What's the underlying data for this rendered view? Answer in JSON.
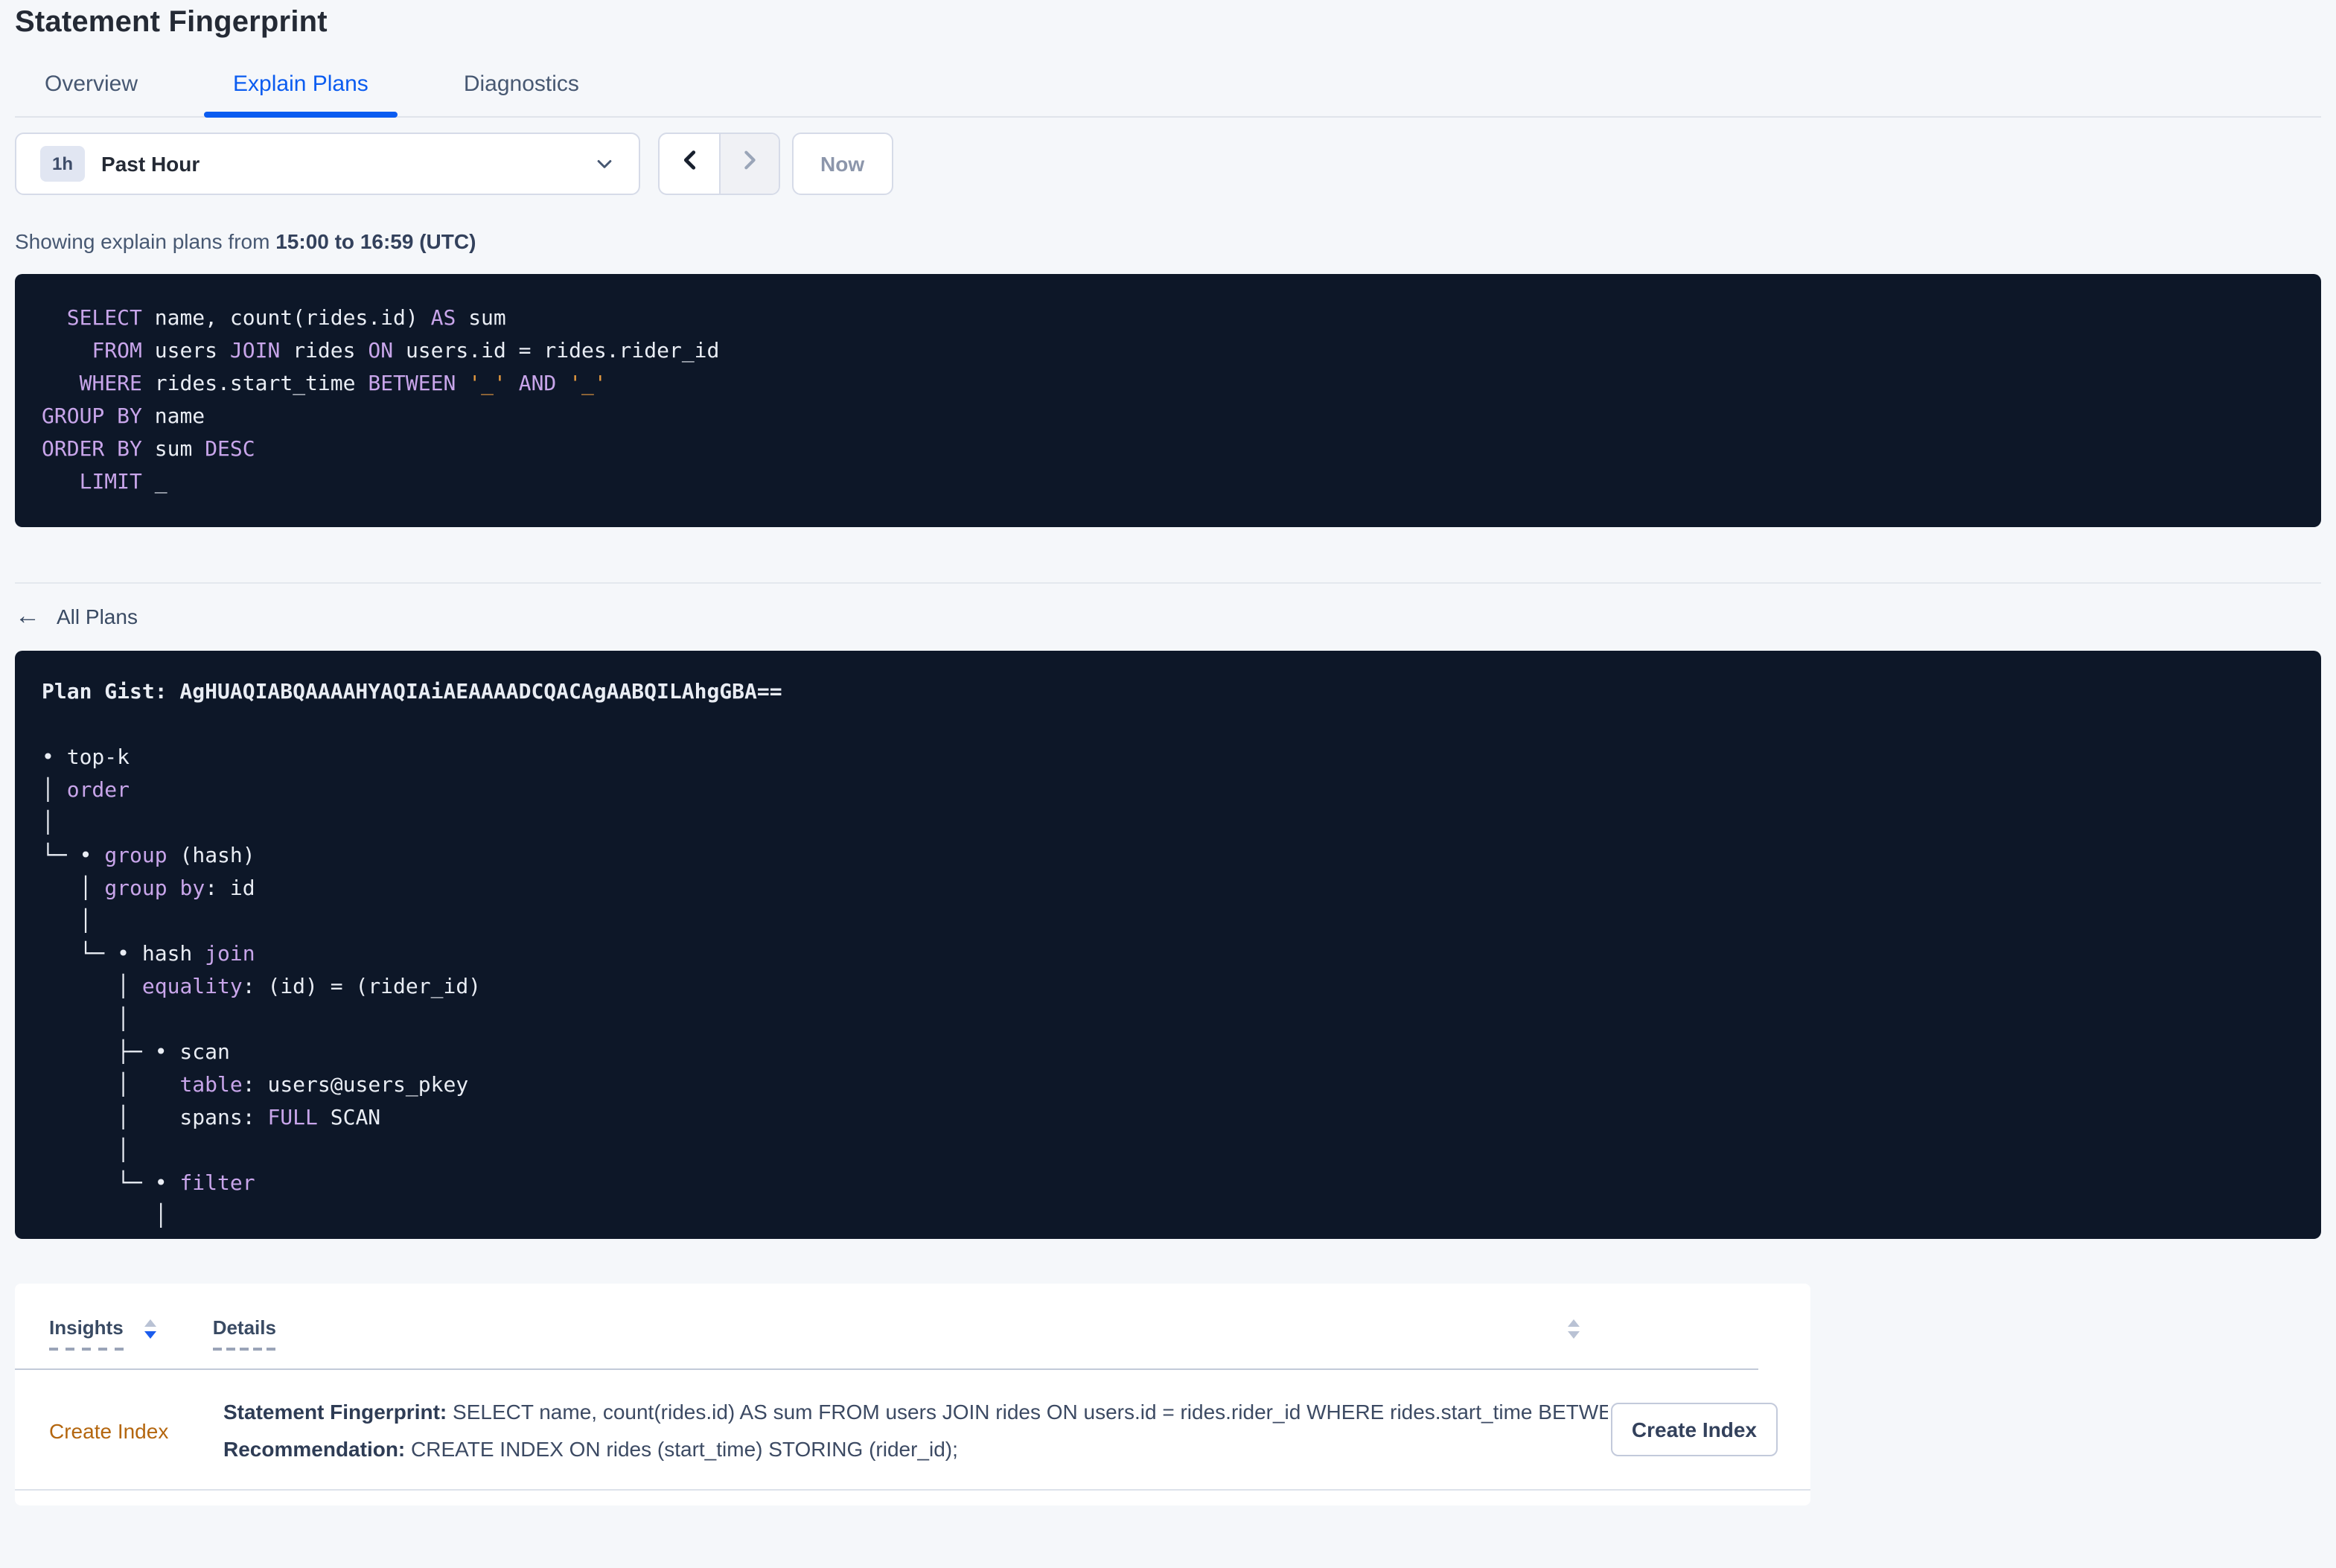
{
  "page": {
    "title": "Statement Fingerprint"
  },
  "tabs": [
    {
      "label": "Overview",
      "active": false
    },
    {
      "label": "Explain Plans",
      "active": true
    },
    {
      "label": "Diagnostics",
      "active": false
    }
  ],
  "time_picker": {
    "interval_badge": "1h",
    "selected": "Past Hour",
    "now_label": "Now"
  },
  "showing": {
    "prefix": "Showing explain plans from ",
    "range": "15:00 to 16:59 (UTC)"
  },
  "sql": {
    "lines": [
      [
        {
          "t": "  "
        },
        {
          "t": "SELECT",
          "c": "k"
        },
        {
          "t": " name, count(rides.id) "
        },
        {
          "t": "AS",
          "c": "k"
        },
        {
          "t": " sum"
        }
      ],
      [
        {
          "t": "    "
        },
        {
          "t": "FROM",
          "c": "k"
        },
        {
          "t": " users "
        },
        {
          "t": "JOIN",
          "c": "k"
        },
        {
          "t": " rides "
        },
        {
          "t": "ON",
          "c": "k"
        },
        {
          "t": " users.id = rides.rider_id"
        }
      ],
      [
        {
          "t": "   "
        },
        {
          "t": "WHERE",
          "c": "k"
        },
        {
          "t": " rides.start_time "
        },
        {
          "t": "BETWEEN",
          "c": "k"
        },
        {
          "t": " "
        },
        {
          "t": "'_'",
          "c": "o"
        },
        {
          "t": " "
        },
        {
          "t": "AND",
          "c": "k"
        },
        {
          "t": " "
        },
        {
          "t": "'_'",
          "c": "o"
        }
      ],
      [
        {
          "t": "GROUP BY",
          "c": "k"
        },
        {
          "t": " name"
        }
      ],
      [
        {
          "t": "ORDER BY",
          "c": "k"
        },
        {
          "t": " sum "
        },
        {
          "t": "DESC",
          "c": "k"
        }
      ],
      [
        {
          "t": "   "
        },
        {
          "t": "LIMIT",
          "c": "k"
        },
        {
          "t": " _"
        }
      ]
    ]
  },
  "plan_section": {
    "back_arrow_icon": "←",
    "back_label": "All Plans"
  },
  "plan": {
    "lines": [
      [
        {
          "t": "Plan Gist: AgHUAQIABQAAAAHYAQIAiAEAAAADCQACAgAABQILAhgGBA==",
          "c": "b"
        }
      ],
      [
        {
          "t": " "
        }
      ],
      [
        {
          "t": "• top-k"
        }
      ],
      [
        {
          "t": "│ "
        },
        {
          "t": "order",
          "c": "k"
        }
      ],
      [
        {
          "t": "│"
        }
      ],
      [
        {
          "t": "└─ • "
        },
        {
          "t": "group",
          "c": "k"
        },
        {
          "t": " (hash)"
        }
      ],
      [
        {
          "t": "   │ "
        },
        {
          "t": "group by",
          "c": "k"
        },
        {
          "t": ": id"
        }
      ],
      [
        {
          "t": "   │"
        }
      ],
      [
        {
          "t": "   └─ • hash "
        },
        {
          "t": "join",
          "c": "k"
        }
      ],
      [
        {
          "t": "      │ "
        },
        {
          "t": "equality",
          "c": "k"
        },
        {
          "t": ": (id) = (rider_id)"
        }
      ],
      [
        {
          "t": "      │"
        }
      ],
      [
        {
          "t": "      ├─ • scan"
        }
      ],
      [
        {
          "t": "      │    "
        },
        {
          "t": "table",
          "c": "k"
        },
        {
          "t": ": users@users_pkey"
        }
      ],
      [
        {
          "t": "      │    spans: "
        },
        {
          "t": "FULL",
          "c": "k"
        },
        {
          "t": " SCAN"
        }
      ],
      [
        {
          "t": "      │"
        }
      ],
      [
        {
          "t": "      └─ • "
        },
        {
          "t": "filter",
          "c": "k"
        }
      ],
      [
        {
          "t": "         │"
        }
      ]
    ]
  },
  "insights": {
    "columns": [
      {
        "label": "Insights"
      },
      {
        "label": "Details"
      }
    ],
    "row": {
      "insight_link": "Create Index",
      "fingerprint_label": "Statement Fingerprint:",
      "fingerprint_text": " SELECT name, count(rides.id) AS sum FROM users JOIN rides ON users.id = rides.rider_id WHERE rides.start_time BETWEEN '_…",
      "recommendation_label": "Recommendation:",
      "recommendation_text": " CREATE INDEX ON rides (start_time) STORING (rider_id);",
      "action_label": "Create Index"
    }
  },
  "colors": {
    "accent_blue": "#0b5cf0",
    "panel_navy": "#0d1728",
    "keyword_purple": "#c8a5ea",
    "literal_orange": "#e59a40",
    "insight_link_orange": "#b4660e",
    "page_background": "#f5f7fa"
  }
}
